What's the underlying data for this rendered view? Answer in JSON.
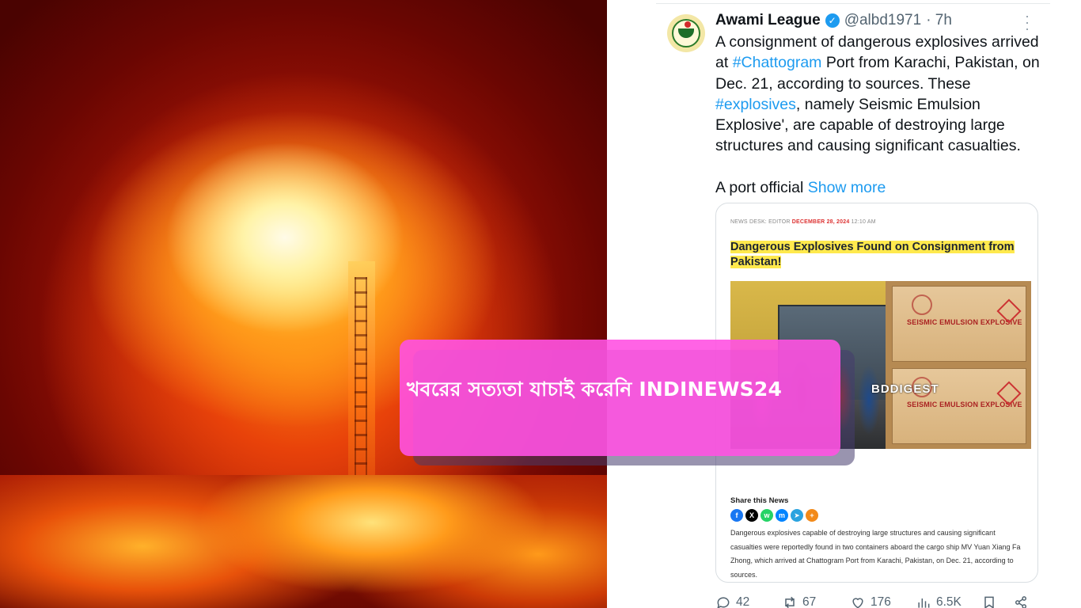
{
  "tweet": {
    "author_name": "Awami League",
    "handle": "@albd1971",
    "time": "· 7h",
    "text_parts": {
      "p1": "A consignment of dangerous explosives arrived at ",
      "tag1": "#Chattogram",
      "p2": " Port from Karachi, Pakistan, on Dec. 21, according to sources. These ",
      "tag2": "#explosives",
      "p3": ", namely Seismic Emulsion Explosive', are capable of destroying large structures and causing significant casualties.",
      "p4": "A port official ",
      "show_more": "Show more"
    },
    "actions": {
      "replies": "42",
      "reposts": "67",
      "likes": "176",
      "views": "6.5K"
    }
  },
  "news_card": {
    "meta_prefix": "NEWS DESK: EDITOR",
    "meta_date": "DECEMBER 28, 2024",
    "meta_time": "12:10 AM",
    "headline": "Dangerous Explosives Found on Consignment from Pakistan!",
    "box_label": "SEISMIC EMULSION EXPLOSIVE",
    "watermark": "BDDIGEST",
    "share_label": "Share this News",
    "share_icons": [
      "facebook-icon",
      "x-icon",
      "whatsapp-icon",
      "messenger-icon",
      "telegram-icon",
      "plus-icon"
    ],
    "body": "Dangerous explosives capable of destroying large structures and causing significant casualties were reportedly found in two containers aboard the cargo ship MV Yuan Xiang Fa Zhong, which arrived at Chattogram Port from Karachi, Pakistan, on Dec. 21, according to sources."
  },
  "banner": {
    "text": "খবরের সত্যতা যাচাই করেনি INDINEWS24",
    "color": "#ff52e2"
  },
  "colors": {
    "link": "#1d9bf0",
    "verified": "#1d9bf0",
    "headline_highlight": "#ffe94d"
  }
}
